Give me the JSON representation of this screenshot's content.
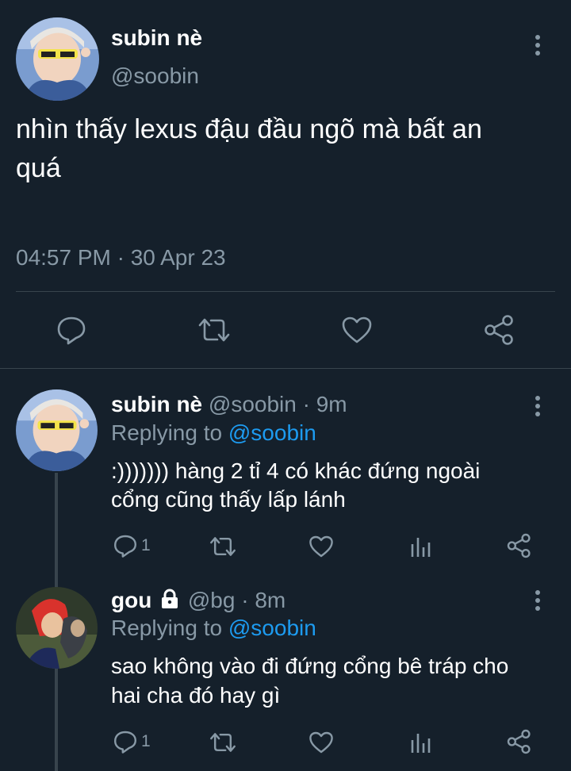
{
  "main_tweet": {
    "display_name": "subin nè",
    "handle": "@soobin",
    "text_line1": "nhìn thấy lexus đậu đầu ngõ mà bất an",
    "text_line2": "quá",
    "timestamp": "04:57 PM · 30 Apr 23",
    "icons": [
      "reply-icon",
      "retweet-icon",
      "like-icon",
      "share-icon",
      "more-icon"
    ]
  },
  "replies": [
    {
      "display_name": "subin nè",
      "handle": "@soobin",
      "time": "· 9m",
      "replying_prefix": "Replying to",
      "replying_to": "@soobin",
      "text_line1": ":))))))) hàng 2 tỉ 4 có khác đứng ngoài",
      "text_line2": "cổng cũng thấy lấp lánh",
      "reply_count": "1"
    },
    {
      "display_name": "gou",
      "handle": "@bg",
      "time": "· 8m",
      "replying_prefix": "Replying to",
      "replying_to": "@soobin",
      "text_line1": "sao không vào đi đứng cổng bê tráp cho",
      "text_line2": "hai cha đó hay gì",
      "reply_count": "1",
      "protected_icon": "lock-icon"
    }
  ],
  "colors": {
    "background": "#15202b",
    "text": "#ffffff",
    "muted": "#8899a6",
    "link": "#1d9bf0",
    "divider": "#38444d"
  }
}
